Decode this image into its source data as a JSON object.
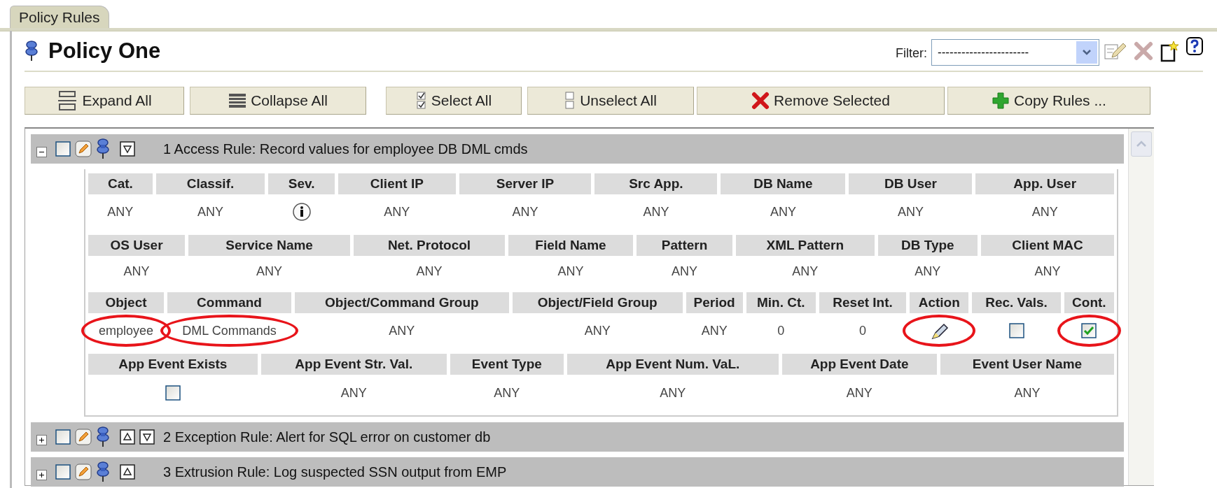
{
  "tab": {
    "label": "Policy Rules",
    "selected": true
  },
  "policy": {
    "title": "Policy One"
  },
  "filter": {
    "label": "Filter:",
    "value": "-----------------------"
  },
  "toolbar": [
    {
      "kind": "expand",
      "label": "Expand All"
    },
    {
      "kind": "collapse",
      "label": "Collapse All"
    },
    {
      "kind": "select",
      "label": "Select All"
    },
    {
      "kind": "unselect",
      "label": "Unselect All"
    },
    {
      "kind": "remove",
      "label": "Remove Selected"
    },
    {
      "kind": "copy",
      "label": "Copy Rules ..."
    }
  ],
  "rules": [
    {
      "title": "1 Access Rule: Record values for employee DB DML cmds",
      "expanded": true,
      "checked": false,
      "move_up": false,
      "move_down": true,
      "sections": [
        [
          {
            "label": "Cat.",
            "kind": "text",
            "value": "ANY",
            "circled": false
          },
          {
            "label": "Classif.",
            "kind": "text",
            "value": "ANY",
            "circled": false
          },
          {
            "label": "Sev.",
            "kind": "info",
            "circled": false
          },
          {
            "label": "Client IP",
            "kind": "text",
            "value": "ANY",
            "circled": false
          },
          {
            "label": "Server IP",
            "kind": "text",
            "value": "ANY",
            "circled": false
          },
          {
            "label": "Src App.",
            "kind": "text",
            "value": "ANY",
            "circled": false
          },
          {
            "label": "DB Name",
            "kind": "text",
            "value": "ANY",
            "circled": false
          },
          {
            "label": "DB User",
            "kind": "text",
            "value": "ANY",
            "circled": false
          },
          {
            "label": "App. User",
            "kind": "text",
            "value": "ANY",
            "circled": false
          }
        ],
        [
          {
            "label": "OS User",
            "kind": "text",
            "value": "ANY",
            "circled": false
          },
          {
            "label": "Service Name",
            "kind": "text",
            "value": "ANY",
            "circled": false
          },
          {
            "label": "Net. Protocol",
            "kind": "text",
            "value": "ANY",
            "circled": false
          },
          {
            "label": "Field Name",
            "kind": "text",
            "value": "ANY",
            "circled": false
          },
          {
            "label": "Pattern",
            "kind": "text",
            "value": "ANY",
            "circled": false
          },
          {
            "label": "XML Pattern",
            "kind": "text",
            "value": "ANY",
            "circled": false
          },
          {
            "label": "DB Type",
            "kind": "text",
            "value": "ANY",
            "circled": false
          },
          {
            "label": "Client MAC",
            "kind": "text",
            "value": "ANY",
            "circled": false
          }
        ],
        [
          {
            "label": "Object",
            "kind": "text",
            "value": "employee",
            "circled": true
          },
          {
            "label": "Command",
            "kind": "text",
            "value": "DML Commands",
            "circled": true
          },
          {
            "label": "Object/Command Group",
            "kind": "text",
            "value": "ANY",
            "circled": false
          },
          {
            "label": "Object/Field Group",
            "kind": "text",
            "value": "ANY",
            "circled": false
          },
          {
            "label": "Period",
            "kind": "text",
            "value": "ANY",
            "circled": false
          },
          {
            "label": "Min. Ct.",
            "kind": "text",
            "value": "0",
            "circled": false
          },
          {
            "label": "Reset Int.",
            "kind": "text",
            "value": "0",
            "circled": false
          },
          {
            "label": "Action",
            "kind": "action",
            "circled": true
          },
          {
            "label": "Rec. Vals.",
            "kind": "checkbox",
            "checked": false,
            "circled": false
          },
          {
            "label": "Cont.",
            "kind": "checkbox",
            "checked": true,
            "circled": true
          }
        ],
        [
          {
            "label": "App Event Exists",
            "kind": "checkbox",
            "checked": false,
            "circled": false
          },
          {
            "label": "App Event Str. Val.",
            "kind": "text",
            "value": "ANY",
            "circled": false
          },
          {
            "label": "Event Type",
            "kind": "text",
            "value": "ANY",
            "circled": false
          },
          {
            "label": "App Event Num. VaL.",
            "kind": "text",
            "value": "ANY",
            "circled": false
          },
          {
            "label": "App Event Date",
            "kind": "text",
            "value": "ANY",
            "circled": false
          },
          {
            "label": "Event User Name",
            "kind": "text",
            "value": "ANY",
            "circled": false
          }
        ]
      ]
    },
    {
      "title": "2 Exception Rule: Alert for SQL error on customer db",
      "expanded": false,
      "checked": false,
      "move_up": true,
      "move_down": true
    },
    {
      "title": "3 Extrusion Rule: Log suspected SSN output from EMP",
      "expanded": false,
      "checked": false,
      "move_up": true,
      "move_down": false
    }
  ]
}
